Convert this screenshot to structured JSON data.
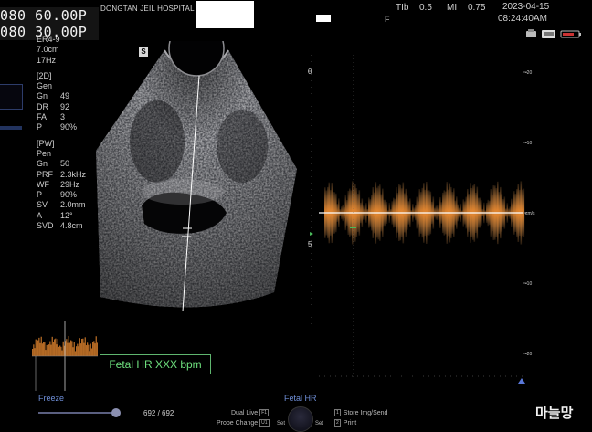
{
  "overlay_stamp": {
    "line1": "080 60.00P",
    "line2": "080 30.00P"
  },
  "header": {
    "hospital": "DONGTAN JEIL HOSPITAL",
    "tib_label": "TIb",
    "tib_value": "0.5",
    "mi_label": "MI",
    "mi_value": "0.75",
    "f_label": "F",
    "date": "2023-04-15",
    "time": "08:24:40AM"
  },
  "status_icons": [
    "printer-icon",
    "network-icon",
    "battery-icon"
  ],
  "parameters": {
    "probe": [
      {
        "label": "ER4-9",
        "value": ""
      },
      {
        "label": "7.0cm",
        "value": ""
      },
      {
        "label": "17Hz",
        "value": ""
      }
    ],
    "mode_2d": {
      "title": "[2D]",
      "rows": [
        {
          "label": "Gen",
          "value": ""
        },
        {
          "label": "Gn",
          "value": "49"
        },
        {
          "label": "DR",
          "value": "92"
        },
        {
          "label": "FA",
          "value": "3"
        },
        {
          "label": "P",
          "value": "90%"
        }
      ]
    },
    "mode_pw": {
      "title": "[PW]",
      "rows": [
        {
          "label": "Pen",
          "value": ""
        },
        {
          "label": "Gn",
          "value": "50"
        },
        {
          "label": "PRF",
          "value": "2.3kHz"
        },
        {
          "label": "WF",
          "value": "29Hz"
        },
        {
          "label": "P",
          "value": "90%"
        },
        {
          "label": "SV",
          "value": "2.0mm"
        },
        {
          "label": "A",
          "value": "12°"
        },
        {
          "label": "SVD",
          "value": "4.8cm"
        }
      ]
    }
  },
  "image_marker": "S",
  "depth_scale": {
    "ticks": [
      "0",
      "5"
    ]
  },
  "doppler": {
    "scale_labels": [
      "-20",
      "-10",
      "cm/s",
      "-10",
      "-20"
    ],
    "scale_values": [
      -20,
      -10,
      0,
      10,
      20
    ],
    "baseline_label": "cm/s"
  },
  "fhr_label": "Fetal HR  XXX bpm",
  "bottom_bar": {
    "freeze": "Freeze",
    "frame_counter": "692 / 692",
    "dual_live": "Dual Live",
    "dual_live_key": "F1",
    "probe_change": "Probe Change",
    "probe_change_key": "U1",
    "fetal_hr": "Fetal HR",
    "set_left": "Set",
    "set_right": "Set",
    "store_key": "1",
    "store": "Store Img/Send",
    "print_key": "2",
    "print": "Print"
  },
  "watermark": "마늘망",
  "colors": {
    "fhr_text": "#6ee07e",
    "accent_blue": "#6f8fd8",
    "doppler_orange": "#e88a32"
  }
}
